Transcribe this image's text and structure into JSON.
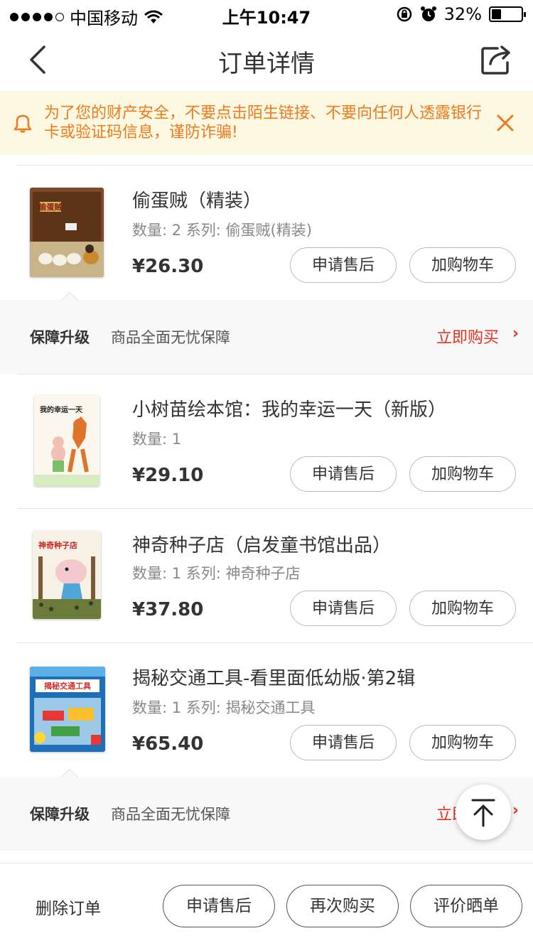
{
  "status_bar": {
    "carrier": "中国移动",
    "time": "上午10:47",
    "battery": "32%",
    "battery_level": 0.32
  },
  "nav": {
    "title": "订单详情",
    "back_icon": "chevron-left-icon",
    "share_icon": "share-icon"
  },
  "notice": {
    "text": "为了您的财产安全，不要点击陌生链接、不要向任何人透露银行卡或验证码信息，谨防诈骗!",
    "icon": "bell-icon",
    "close_icon": "close-icon"
  },
  "products": [
    {
      "title": "偷蛋贼（精装）",
      "qty": "数量: 2 系列: 偷蛋贼(精装)",
      "price": "¥26.30",
      "after_sale": "申请售后",
      "add_cart": "加购物车",
      "cover_text": "偷蛋贼"
    },
    {
      "title": "小树苗绘本馆：我的幸运一天（新版）",
      "qty": "数量: 1",
      "price": "¥29.10",
      "after_sale": "申请售后",
      "add_cart": "加购物车",
      "cover_text": "我的幸运一天"
    },
    {
      "title": "神奇种子店（启发童书馆出品）",
      "qty": "数量: 1 系列: 神奇种子店",
      "price": "¥37.80",
      "after_sale": "申请售后",
      "add_cart": "加购物车",
      "cover_text": "神奇种子店"
    },
    {
      "title": "揭秘交通工具-看里面低幼版·第2辑",
      "qty": "数量: 1 系列: 揭秘交通工具",
      "price": "¥65.40",
      "after_sale": "申请售后",
      "add_cart": "加购物车",
      "cover_text": "揭秘交通工具"
    }
  ],
  "guarantee": {
    "label": "保障升级",
    "desc": "商品全面无忧保障",
    "buy": "立即购买",
    "arrow": "›"
  },
  "bottom_bar": {
    "delete": "删除订单",
    "after_sale": "申请售后",
    "rebuy": "再次购买",
    "review": "评价晒单"
  },
  "colors": {
    "accent_red": "#e6321e",
    "notice_orange": "#ef7a1e",
    "notice_bg": "#fdf8e1"
  }
}
